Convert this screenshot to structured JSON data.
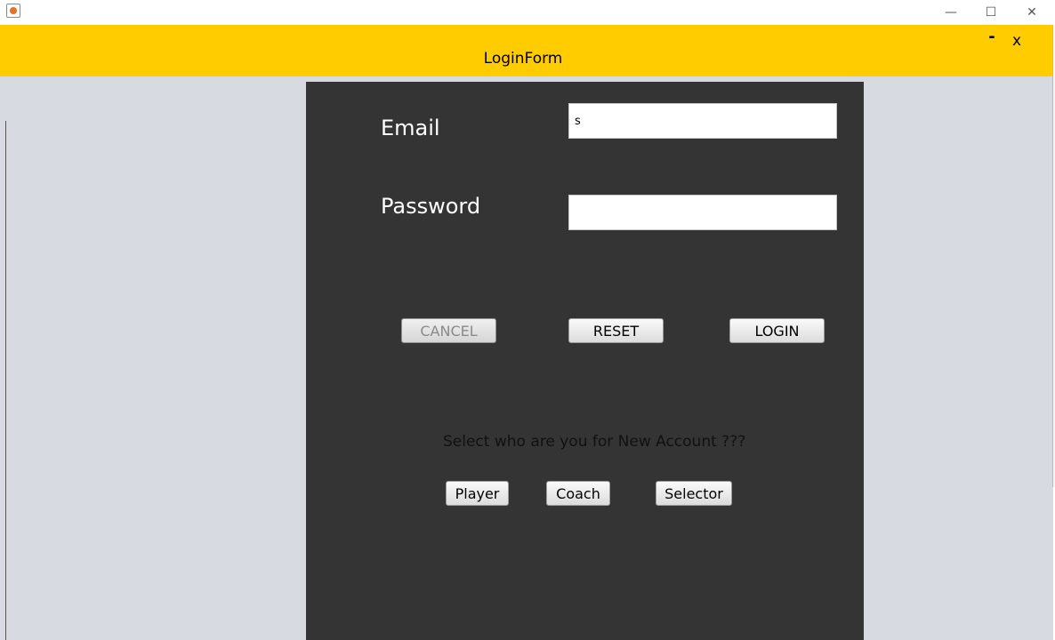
{
  "window": {
    "app_icon": "java-cup-icon",
    "minimize_symbol": "—",
    "maximize_symbol": "☐",
    "close_symbol": "✕"
  },
  "header": {
    "title": "LoginForm",
    "minimize_label": "-",
    "close_label": "x",
    "background_color": "#ffcc00"
  },
  "form": {
    "email_label": "Email",
    "email_value": "s",
    "password_label": "Password",
    "password_value": "",
    "cancel_label": "CANCEL",
    "reset_label": "RESET",
    "login_label": "LOGIN",
    "select_prompt": "Select who are you for New Account ???",
    "player_label": "Player",
    "coach_label": "Coach",
    "selector_label": "Selector",
    "panel_color": "#343434"
  }
}
